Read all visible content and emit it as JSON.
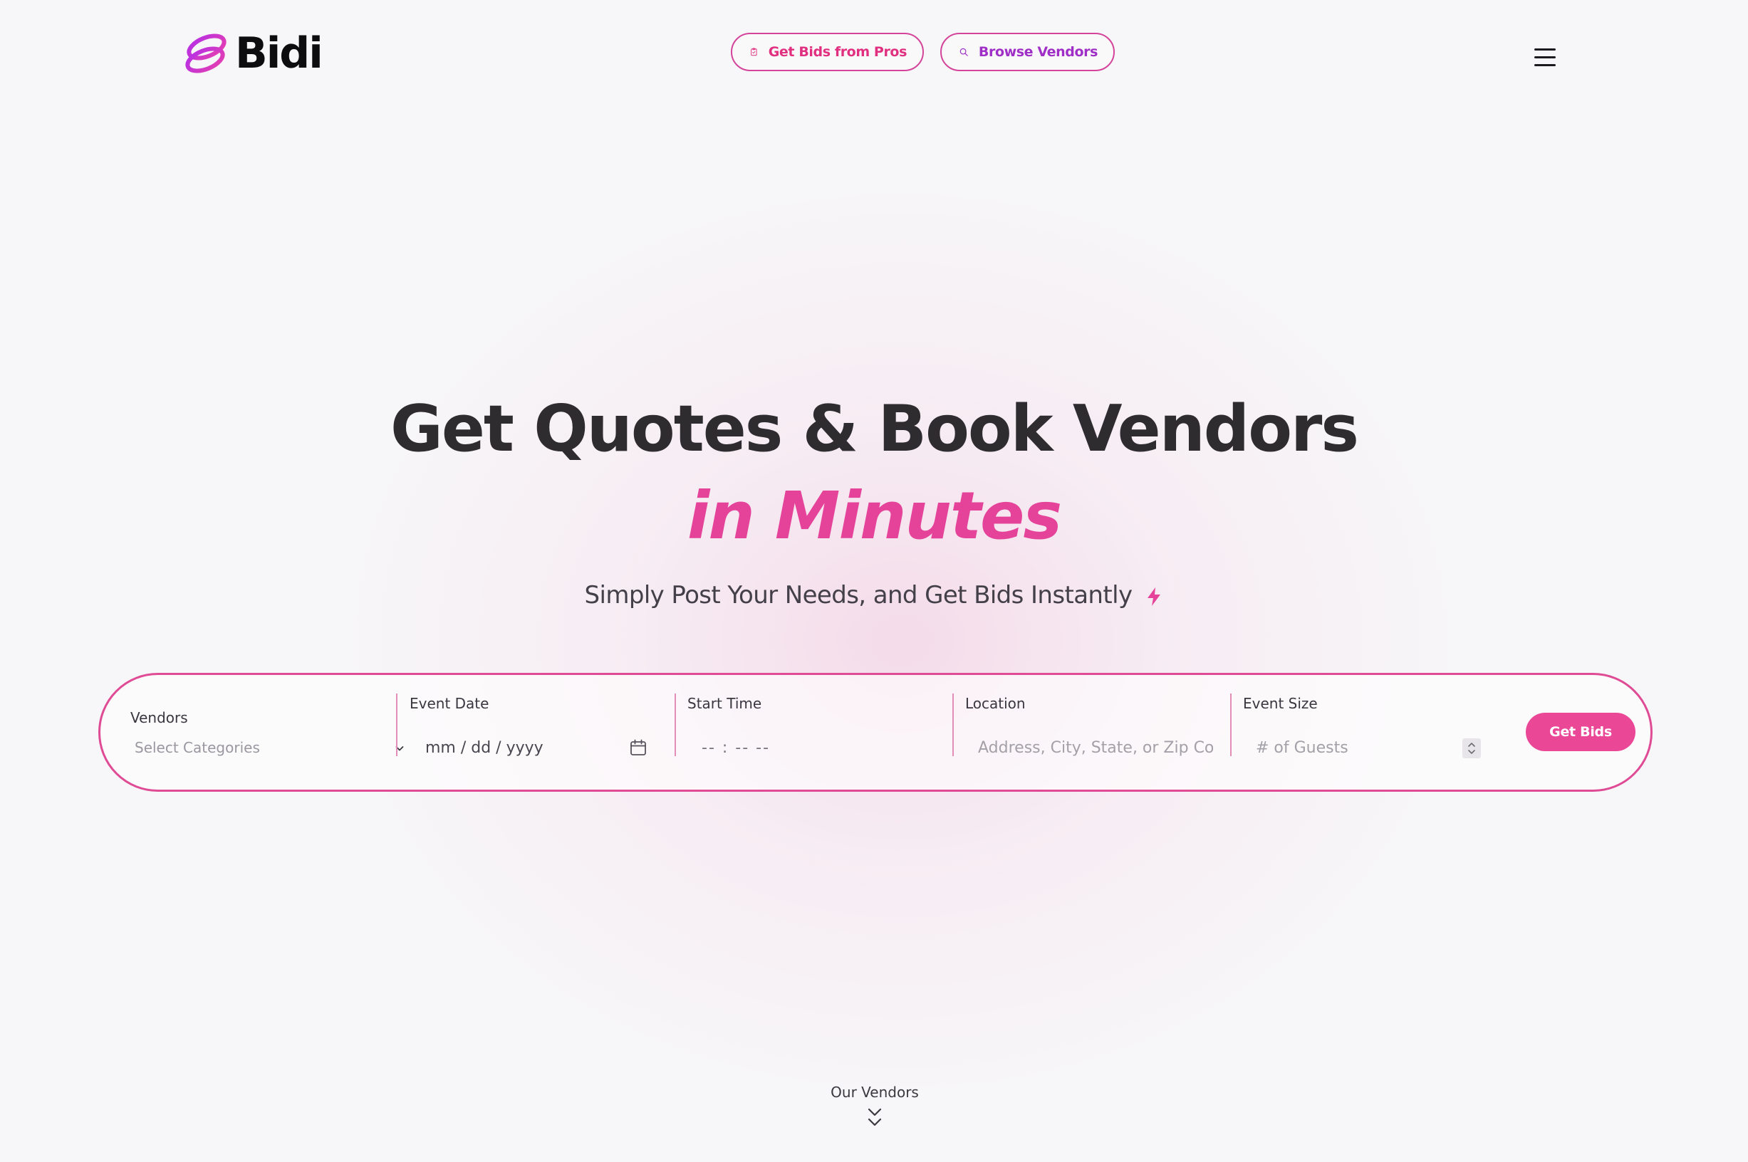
{
  "header": {
    "logo_text": "Bidi",
    "nav": {
      "get_bids_label": "Get Bids from Pros",
      "browse_vendors_label": "Browse Vendors"
    }
  },
  "hero": {
    "title": "Get Quotes & Book Vendors",
    "title_accent": "in Minutes",
    "subtitle": "Simply Post Your Needs, and Get Bids Instantly"
  },
  "search": {
    "vendors": {
      "label": "Vendors",
      "value": "Select Categories"
    },
    "event_date": {
      "label": "Event Date",
      "value": "mm / dd / yyyy"
    },
    "start_time": {
      "label": "Start Time",
      "value": "-- : --  --"
    },
    "location": {
      "label": "Location",
      "placeholder": "Address, City, State, or Zip Code"
    },
    "event_size": {
      "label": "Event Size",
      "placeholder": "# of Guests"
    },
    "submit_label": "Get Bids"
  },
  "footer_link": {
    "label": "Our Vendors"
  },
  "colors": {
    "brand_pink": "#e5439a",
    "brand_purple": "#9f2fc7",
    "background": "#f7f6f8",
    "text_dark": "#2e2c2f"
  }
}
